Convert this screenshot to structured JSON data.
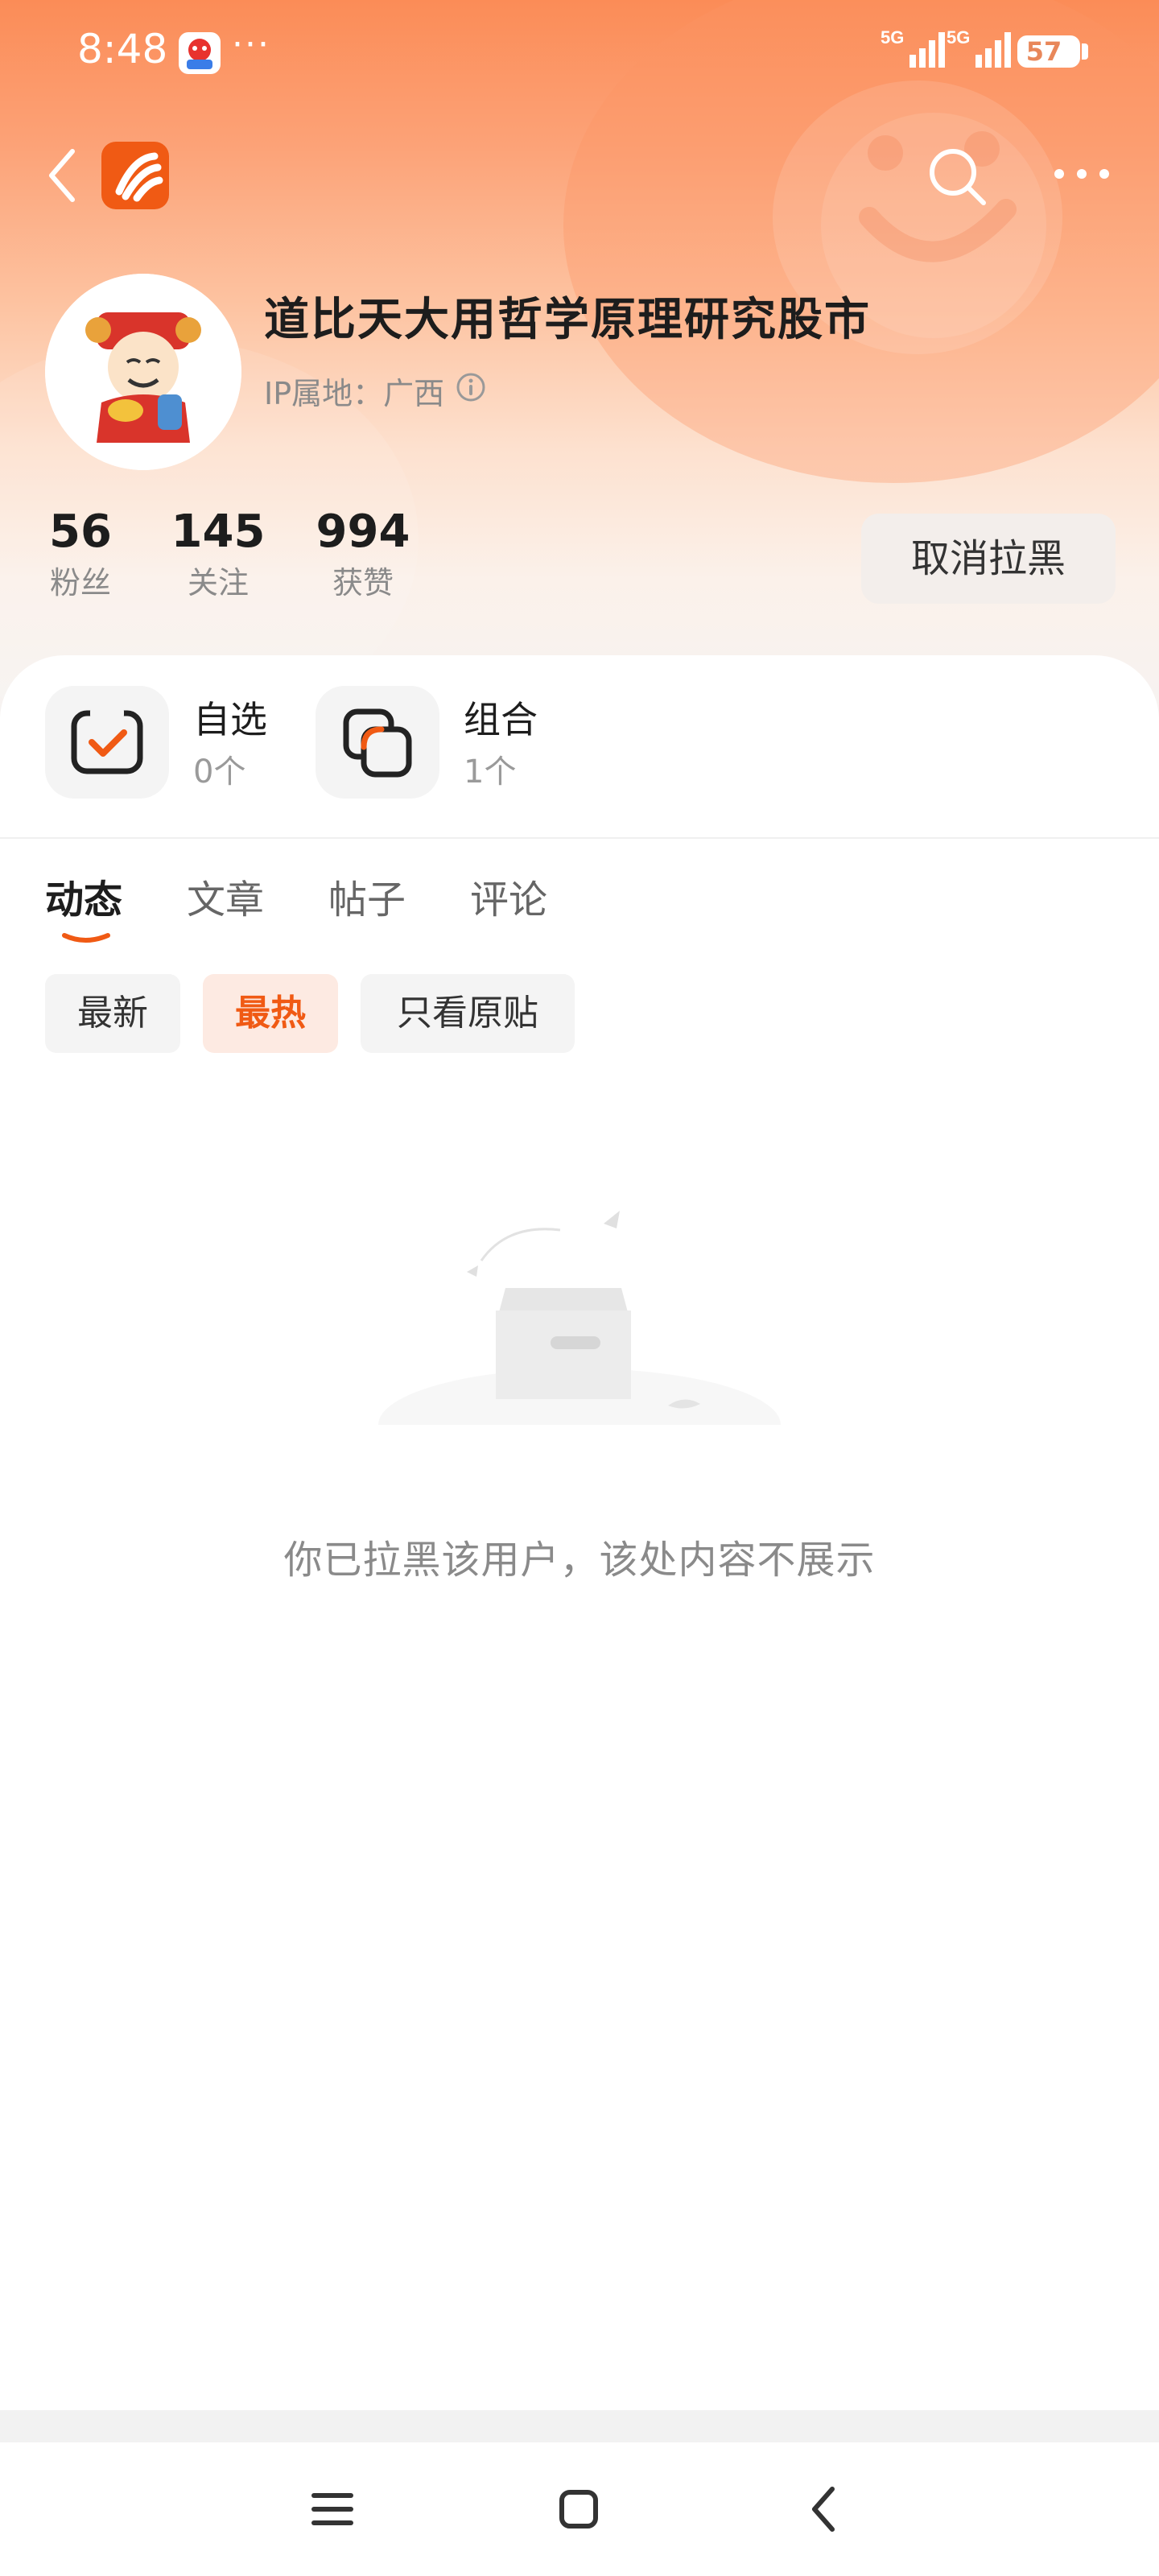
{
  "status_bar": {
    "time": "8:48",
    "more": "···",
    "signal1": "5G",
    "signal2": "5G",
    "battery": "57"
  },
  "nav": {
    "back_icon": "chevron-left-icon",
    "logo_icon": "app-logo-icon",
    "search_icon": "search-icon",
    "more_icon": "more-dots-icon"
  },
  "profile": {
    "username": "道比天大用哲学原理研究股市",
    "ip_location": "IP属地：广西",
    "stats": [
      {
        "value": "56",
        "label": "粉丝"
      },
      {
        "value": "145",
        "label": "关注"
      },
      {
        "value": "994",
        "label": "获赞"
      }
    ],
    "unblock_label": "取消拉黑"
  },
  "tools": [
    {
      "title": "自选",
      "sub": "0个",
      "icon": "watchlist-check-icon"
    },
    {
      "title": "组合",
      "sub": "1个",
      "icon": "portfolio-icon"
    }
  ],
  "tabs": [
    {
      "label": "动态",
      "active": true
    },
    {
      "label": "文章",
      "active": false
    },
    {
      "label": "帖子",
      "active": false
    },
    {
      "label": "评论",
      "active": false
    }
  ],
  "filters": [
    {
      "label": "最新",
      "active": false
    },
    {
      "label": "最热",
      "active": true
    },
    {
      "label": "只看原贴",
      "active": false
    }
  ],
  "empty_state": {
    "message": "你已拉黑该用户，该处内容不展示",
    "icon": "empty-box-icon"
  },
  "colors": {
    "accent": "#f05a14",
    "header_top": "#fb8c57"
  }
}
